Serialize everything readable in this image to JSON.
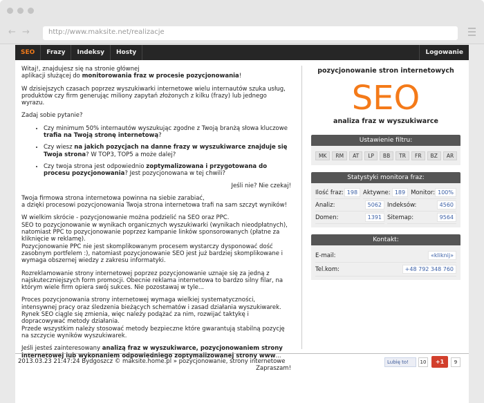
{
  "browser": {
    "url": "http://www.maksite.net/realizacje"
  },
  "nav": {
    "items": [
      "SEO",
      "Frazy",
      "Indeksy",
      "Hosty"
    ],
    "login": "Logowanie"
  },
  "left": {
    "intro_1": "Witaj!, znajdujesz się na stronie głównej",
    "intro_2a": "aplikacji służącej do ",
    "intro_2b": "monitorowania fraz w procesie pozycjonowania",
    "intro_2c": "!",
    "p2": "W dzisiejszych czasach poprzez wyszukiwarki internetowe wielu internautów szuka usług, produktów czy firm generując miliony zapytań złożonych z kilku (frazy) lub jednego wyrazu.",
    "p3": "Zadaj sobie pytanie?",
    "q1a": "Czy minimum 50% internautów wyszukując zgodne z Twoją branżą słowa kluczowe ",
    "q1b": "trafia na Twoją stronę internetową",
    "q1c": "?",
    "q2a": "Czy wiesz ",
    "q2b": "na jakich pozycjach na danne frazy w wyszukiwarce znajduje się Twoja strona",
    "q2c": "? W TOP3, TOP5 a może dalej?",
    "q3a": "Czy twoja strona jest odpowiednio ",
    "q3b": "zoptymalizowana i przygotowana do procesu pozycjonowania",
    "q3c": "? Jest pozycjonowana w tej chwili?",
    "cta": "Jeśli nie? Nie czekaj!",
    "p4a": "Twoja firmowa strona internetowa powinna na siebie zarabiać,",
    "p4b": "a dzięki procesowi pozycjonowania Twoja strona internetowa trafi na sam szczyt wyników!",
    "p5": "W wielkim skrócie - pozycjonowanie można podzielić na SEO oraz PPC.\nSEO to pozycjonowanie w wynikach organicznych wyszukiwarki (wynikach nieodpłatnych), natomiast PPC to pozycjonowanie poprzez kampanie linków sponsorowanych (płatne za kliknięcie w reklamę).\nPozycjonowanie PPC nie jest skomplikowanym procesem wystarczy dysponować dość zasobnym portfelem :), natomiast pozycjonowanie SEO jest już bardziej skomplikowane i wymaga obszernej wiedzy z zakresu informatyki.",
    "p6": "Rozreklamowanie strony internetowej poprzez pozycjonowanie uznaje się za jedną z najskuteczniejszych form promocji. Obecnie reklama internetowa to bardzo silny filar, na którym wiele firm opiera swój sukces. Nie pozostawaj w tyle...",
    "p7": "Proces pozycjonowania strony internetowej wymaga wielkiej systematyczności, intensywnej pracy oraz śledzenia bieżących schematów i zasad działania wyszukiwarek.\nRynek SEO ciągle się zmienia, więc należy podążać za nim, rozwijać taktykę i dopracowywać metody działania.\nPrzede wszystkim należy stosować metody bezpieczne które gwarantują stabilną pozycję na szczycie wyników wyszukiwarek.",
    "p8a": "Jeśli jesteś zainteresowany ",
    "p8b": "analizą fraz w wyszukiwarce, pozycjonowaniem strony internetowej lub wykonaniem odpowiedniego zoptymalizowanej strony www",
    "p8c": "...",
    "closing": "Zapraszam!"
  },
  "right": {
    "header": "pozycjonowanie stron internetowych",
    "seo": "SEO",
    "subheader": "analiza fraz w wyszukiwarce",
    "filter_title": "Ustawienie filtru:",
    "filter_tags": [
      "MK",
      "RM",
      "AT",
      "LP",
      "BB",
      "TR",
      "FR",
      "BZ",
      "AR"
    ],
    "stats_title": "Statystyki monitora fraz:",
    "stats_row1": [
      {
        "label": "Ilość fraz:",
        "value": "198"
      },
      {
        "label": "Aktywne:",
        "value": "189"
      },
      {
        "label": "Monitor:",
        "value": "100%"
      }
    ],
    "stats_row2": [
      {
        "label": "Analiz:",
        "value": "5062"
      },
      {
        "label": "Indeksów:",
        "value": "4560"
      }
    ],
    "stats_row3": [
      {
        "label": "Domen:",
        "value": "1391"
      },
      {
        "label": "Sitemap:",
        "value": "9564"
      }
    ],
    "contact_title": "Kontakt:",
    "email_label": "E-mail:",
    "email_value": "«kliknij»",
    "phone_label": "Tel.kom:",
    "phone_value": "+48 792 348 760"
  },
  "footer": {
    "text": "2013.03.23 21:47:24 Bydgoszcz © maksite.home.pl » pozycjonowanie, strony internetowe",
    "fb_label": "Lubię to!",
    "fb_count": "10",
    "gplus_label": "+1",
    "gplus_count": "9"
  }
}
